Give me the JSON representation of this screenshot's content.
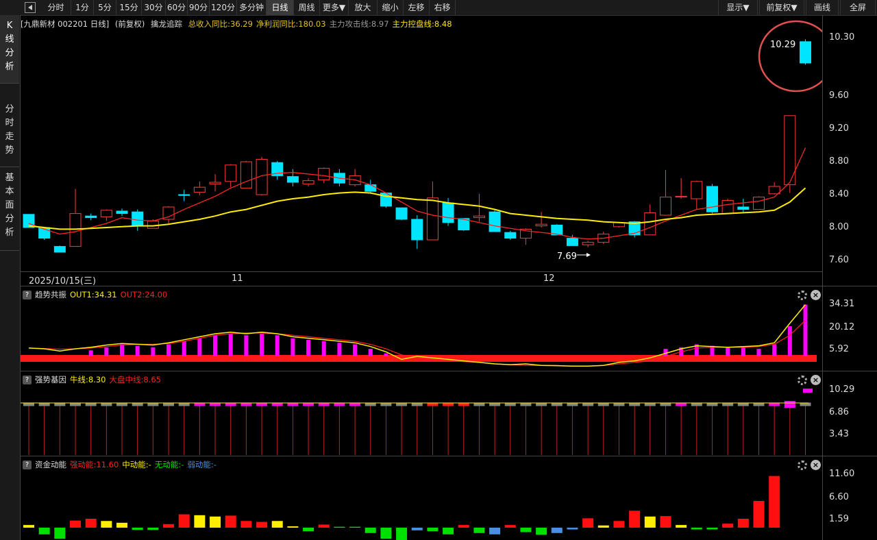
{
  "toolbar": {
    "left": [
      "分时",
      "1分",
      "5分",
      "15分",
      "30分",
      "60分",
      "90分",
      "120分",
      "多分钟",
      "日线",
      "周线",
      "更多▼",
      "放大",
      "缩小",
      "左移",
      "右移"
    ],
    "active": "日线",
    "right": [
      "显示▼",
      "前复权▼",
      "画线",
      "全屏"
    ]
  },
  "sidebar": {
    "tabs": [
      "K线分析",
      "分时走势",
      "基本面分析"
    ],
    "active": "K线分析"
  },
  "main_header": {
    "stock": "[九鼎新材 002201 日线]",
    "adjust": "(前复权)",
    "indicator": "擒龙追踪",
    "items": [
      {
        "text": "总收入同比:36.29",
        "color": "#e0c020"
      },
      {
        "text": "净利润同比:180.03",
        "color": "#e0c020"
      },
      {
        "text": "主力攻击线:8.97",
        "color": "#9a9a9a"
      },
      {
        "text": "主力控盘线:8.48",
        "color": "#ffe000"
      }
    ]
  },
  "main_axis": {
    "labels": [
      "10.30",
      "9.60",
      "9.20",
      "8.80",
      "8.40",
      "8.00",
      "7.60"
    ]
  },
  "x_axis": {
    "labels": [
      "2025/10/15(三)",
      "11",
      "12"
    ]
  },
  "annotations": {
    "high_label": "10.29",
    "low_label": "7.69"
  },
  "panel1": {
    "name": "趋势共振",
    "out1": "OUT1:34.31",
    "out2": "OUT2:24.00",
    "axis": [
      "34.31",
      "20.12",
      "5.92"
    ]
  },
  "panel2": {
    "name": "强势基因",
    "bull": "牛线:8.30",
    "market": "大盘中线:8.65",
    "axis": [
      "10.29",
      "6.86",
      "3.43"
    ]
  },
  "panel3": {
    "name": "资金动能",
    "strong": "强动能:11.60",
    "mid": "中动能:-",
    "none": "无动能:-",
    "weak": "弱动能:-",
    "axis": [
      "11.60",
      "6.60",
      "1.59"
    ]
  },
  "colors": {
    "up": "#ff3b3b",
    "down": "#00e5ff",
    "ma_yellow": "#ffee00",
    "ma_red": "#ff2020",
    "ma_gray": "#9a9a9a",
    "magenta": "#ff00ff",
    "strong": "#ff1010",
    "mid": "#ffee00",
    "none": "#00e000",
    "weak": "#4a90e2"
  },
  "chart_data": {
    "type": "candlestick",
    "ylim": [
      7.55,
      10.35
    ],
    "candles": [
      [
        8.16,
        8.16,
        8.0,
        8.0
      ],
      [
        8.0,
        8.0,
        7.85,
        7.87
      ],
      [
        7.77,
        7.78,
        7.7,
        7.7
      ],
      [
        7.77,
        8.47,
        7.77,
        8.17
      ],
      [
        8.14,
        8.17,
        8.09,
        8.12
      ],
      [
        8.13,
        8.22,
        8.08,
        8.21
      ],
      [
        8.2,
        8.23,
        8.14,
        8.17
      ],
      [
        8.19,
        8.22,
        7.96,
        8.02
      ],
      [
        7.99,
        8.1,
        7.99,
        8.08
      ],
      [
        8.1,
        8.26,
        8.05,
        8.25
      ],
      [
        8.4,
        8.46,
        8.32,
        8.39
      ],
      [
        8.43,
        8.56,
        8.39,
        8.49
      ],
      [
        8.53,
        8.65,
        8.44,
        8.55
      ],
      [
        8.56,
        8.77,
        8.49,
        8.76
      ],
      [
        8.48,
        8.81,
        8.48,
        8.8
      ],
      [
        8.4,
        8.86,
        8.39,
        8.83
      ],
      [
        8.79,
        8.81,
        8.58,
        8.63
      ],
      [
        8.62,
        8.71,
        8.5,
        8.55
      ],
      [
        8.53,
        8.6,
        8.5,
        8.57
      ],
      [
        8.58,
        8.73,
        8.54,
        8.72
      ],
      [
        8.66,
        8.71,
        8.5,
        8.54
      ],
      [
        8.52,
        8.71,
        8.5,
        8.63
      ],
      [
        8.52,
        8.58,
        8.42,
        8.44
      ],
      [
        8.42,
        8.42,
        8.24,
        8.26
      ],
      [
        8.24,
        8.24,
        8.09,
        8.1
      ],
      [
        8.1,
        8.15,
        7.74,
        7.85
      ],
      [
        7.85,
        8.56,
        7.85,
        8.36
      ],
      [
        8.3,
        8.36,
        8.02,
        8.06
      ],
      [
        8.11,
        8.11,
        7.96,
        7.97
      ],
      [
        8.12,
        8.41,
        8.07,
        8.14
      ],
      [
        8.19,
        8.21,
        7.95,
        7.95
      ],
      [
        7.94,
        7.96,
        7.85,
        7.87
      ],
      [
        7.87,
        7.99,
        7.79,
        7.98
      ],
      [
        8.02,
        8.19,
        8.0,
        8.04
      ],
      [
        8.03,
        8.04,
        7.91,
        7.91
      ],
      [
        7.87,
        7.91,
        7.78,
        7.78
      ],
      [
        7.79,
        7.84,
        7.76,
        7.82
      ],
      [
        7.82,
        7.95,
        7.8,
        7.92
      ],
      [
        8.01,
        8.07,
        8.0,
        8.06
      ],
      [
        8.07,
        8.08,
        7.88,
        7.91
      ],
      [
        7.91,
        8.28,
        7.91,
        8.18
      ],
      [
        8.15,
        8.7,
        8.15,
        8.37
      ],
      [
        8.37,
        8.6,
        8.35,
        8.38
      ],
      [
        8.35,
        8.57,
        8.22,
        8.56
      ],
      [
        8.5,
        8.53,
        8.17,
        8.19
      ],
      [
        8.17,
        8.35,
        8.17,
        8.33
      ],
      [
        8.25,
        8.35,
        8.19,
        8.22
      ],
      [
        8.22,
        8.38,
        8.22,
        8.37
      ],
      [
        8.41,
        8.55,
        8.4,
        8.5
      ],
      [
        8.52,
        9.36,
        8.42,
        9.36
      ],
      [
        10.26,
        10.29,
        9.98,
        10.0
      ]
    ],
    "ma_yellow": [
      8.02,
      8.0,
      7.98,
      7.98,
      7.99,
      8.0,
      8.01,
      8.02,
      8.02,
      8.04,
      8.07,
      8.1,
      8.14,
      8.19,
      8.22,
      8.27,
      8.32,
      8.35,
      8.37,
      8.4,
      8.42,
      8.43,
      8.42,
      8.38,
      8.36,
      8.34,
      8.33,
      8.3,
      8.28,
      8.26,
      8.22,
      8.17,
      8.15,
      8.13,
      8.11,
      8.1,
      8.09,
      8.07,
      8.06,
      8.05,
      8.07,
      8.1,
      8.12,
      8.15,
      8.16,
      8.17,
      8.18,
      8.19,
      8.21,
      8.31,
      8.48
    ],
    "ma_red": [
      8.05,
      7.98,
      7.92,
      7.95,
      8.0,
      8.05,
      8.12,
      8.09,
      8.08,
      8.13,
      8.22,
      8.3,
      8.38,
      8.48,
      8.56,
      8.63,
      8.66,
      8.67,
      8.65,
      8.63,
      8.6,
      8.58,
      8.52,
      8.42,
      8.31,
      8.2,
      8.15,
      8.12,
      8.1,
      8.06,
      8.02,
      7.99,
      7.96,
      7.94,
      7.92,
      7.88,
      7.86,
      7.87,
      7.9,
      7.93,
      8.0,
      8.08,
      8.15,
      8.22,
      8.25,
      8.28,
      8.3,
      8.32,
      8.37,
      8.55,
      8.97
    ],
    "panel1_bars": [
      0,
      0,
      0,
      0,
      4,
      6,
      8,
      7,
      6,
      8,
      10,
      12,
      14,
      15,
      14,
      15,
      14,
      12,
      11,
      10,
      9,
      8,
      5,
      2,
      0,
      0,
      0,
      0,
      0,
      0,
      0,
      0,
      0,
      0,
      0,
      0,
      0,
      0,
      0,
      0,
      0,
      5,
      6,
      8,
      7,
      6,
      6,
      5,
      8,
      20,
      34.31
    ],
    "panel1_out1": [
      5.5,
      5.0,
      3.5,
      5.0,
      6.0,
      7.5,
      8.5,
      8.0,
      7.5,
      9.0,
      11,
      13,
      15,
      16,
      15,
      16,
      15,
      13,
      12,
      11,
      10,
      9,
      6.5,
      3,
      -2,
      0,
      -1,
      -2,
      -3,
      -4,
      -5,
      -5.5,
      -5,
      -6,
      -6.2,
      -6.5,
      -6.5,
      -6,
      -4,
      -3,
      -1,
      2,
      5,
      7,
      6.5,
      6,
      6.5,
      7,
      9,
      22,
      34.31
    ],
    "panel1_out2": [
      5.5,
      5.2,
      4.8,
      5.0,
      5.5,
      6.5,
      7.5,
      8.0,
      8.0,
      8.5,
      10,
      12,
      14,
      15,
      15.5,
      15.5,
      15,
      14,
      13,
      12,
      11,
      10,
      8,
      5,
      1,
      -1,
      -2,
      -3,
      -3.5,
      -4,
      -5,
      -5.5,
      -6,
      -6,
      -6,
      -6.5,
      -6.5,
      -6,
      -5,
      -4,
      -3,
      0,
      3,
      5.5,
      6,
      6,
      6,
      6.5,
      8,
      14,
      24.0
    ],
    "panel3_bars": [
      [
        0.6,
        "mid"
      ],
      [
        -1.5,
        "none"
      ],
      [
        -2.5,
        "none"
      ],
      [
        1.6,
        "strong"
      ],
      [
        2.0,
        "strong"
      ],
      [
        1.5,
        "mid"
      ],
      [
        1.1,
        "mid"
      ],
      [
        -0.5,
        "none"
      ],
      [
        -0.5,
        "none"
      ],
      [
        0.8,
        "strong"
      ],
      [
        3.0,
        "strong"
      ],
      [
        2.8,
        "mid"
      ],
      [
        2.5,
        "mid"
      ],
      [
        2.7,
        "strong"
      ],
      [
        1.5,
        "strong"
      ],
      [
        1.3,
        "strong"
      ],
      [
        1.5,
        "mid"
      ],
      [
        0.3,
        "mid"
      ],
      [
        -0.8,
        "none"
      ],
      [
        0.7,
        "strong"
      ],
      [
        0.2,
        "none"
      ],
      [
        0.2,
        "none"
      ],
      [
        -1.2,
        "none"
      ],
      [
        -2.5,
        "none"
      ],
      [
        -3.5,
        "none"
      ],
      [
        -0.6,
        "weak"
      ],
      [
        -0.8,
        "none"
      ],
      [
        -1.5,
        "none"
      ],
      [
        0.6,
        "strong"
      ],
      [
        -1.2,
        "none"
      ],
      [
        -1.5,
        "weak"
      ],
      [
        0.6,
        "strong"
      ],
      [
        -1.0,
        "none"
      ],
      [
        -1.6,
        "none"
      ],
      [
        -1.2,
        "weak"
      ],
      [
        -0.4,
        "weak"
      ],
      [
        2.1,
        "strong"
      ],
      [
        0.5,
        "mid"
      ],
      [
        1.5,
        "strong"
      ],
      [
        3.8,
        "strong"
      ],
      [
        2.5,
        "mid"
      ],
      [
        2.6,
        "strong"
      ],
      [
        0.6,
        "mid"
      ],
      [
        -0.4,
        "none"
      ],
      [
        -0.4,
        "none"
      ],
      [
        0.9,
        "strong"
      ],
      [
        2.0,
        "strong"
      ],
      [
        6.0,
        "strong"
      ],
      [
        11.6,
        "strong"
      ]
    ]
  }
}
